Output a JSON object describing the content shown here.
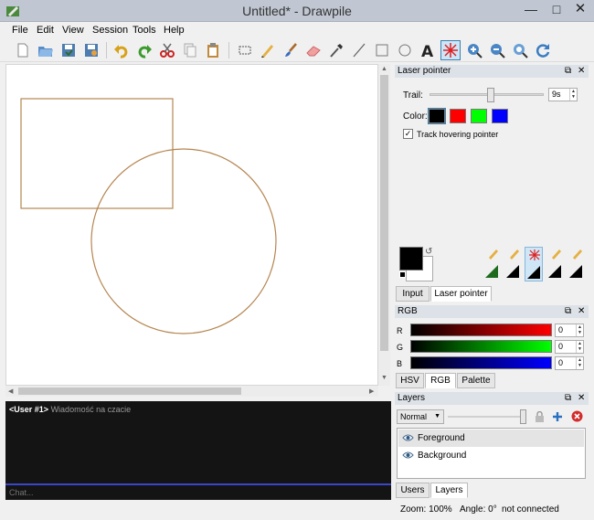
{
  "window": {
    "title": "Untitled* - Drawpile"
  },
  "menu": [
    "File",
    "Edit",
    "View",
    "Session",
    "Tools",
    "Help"
  ],
  "toolbar": {
    "buttons": [
      "new",
      "open",
      "save",
      "save-as",
      "undo",
      "redo",
      "cut",
      "copy",
      "paste",
      "selection",
      "pencil",
      "brush",
      "eraser",
      "color-picker",
      "line",
      "rectangle",
      "ellipse",
      "text",
      "laser-pointer",
      "zoom-in",
      "zoom-out",
      "zoom-reset",
      "rotate-reset"
    ],
    "active": "laser-pointer"
  },
  "laser_dock": {
    "title": "Laser pointer",
    "trail_label": "Trail:",
    "trail_value": "9s",
    "trail_fraction": 0.53,
    "color_label": "Color:",
    "colors": [
      "#000000",
      "#ff0000",
      "#00ff00",
      "#0000ff"
    ],
    "selected_color": 0,
    "track_label": "Track hovering pointer",
    "track_checked": true
  },
  "tool_tabs": [
    "Input",
    "Laser pointer"
  ],
  "tool_tabs_selected": 1,
  "rgb_dock": {
    "title": "RGB",
    "channels": [
      {
        "label": "R",
        "value": "0",
        "color": "#ff0000"
      },
      {
        "label": "G",
        "value": "0",
        "color": "#00ff00"
      },
      {
        "label": "B",
        "value": "0",
        "color": "#0000ff"
      }
    ]
  },
  "color_tabs": [
    "HSV",
    "RGB",
    "Palette"
  ],
  "color_tabs_selected": 1,
  "layers_dock": {
    "title": "Layers",
    "blend_mode": "Normal",
    "opacity_fraction": 1.0,
    "layers": [
      {
        "name": "Foreground",
        "selected": true
      },
      {
        "name": "Background",
        "selected": false
      }
    ]
  },
  "bottom_tabs": [
    "Users",
    "Layers"
  ],
  "bottom_tabs_selected": 1,
  "chat": {
    "user": "<User #1>",
    "message": "Wiadomość na czacie",
    "placeholder": "Chat..."
  },
  "status": {
    "zoom": "Zoom: 100%",
    "angle": "Angle: 0°",
    "connection": "not connected"
  },
  "stroke_color": "#b5854f"
}
